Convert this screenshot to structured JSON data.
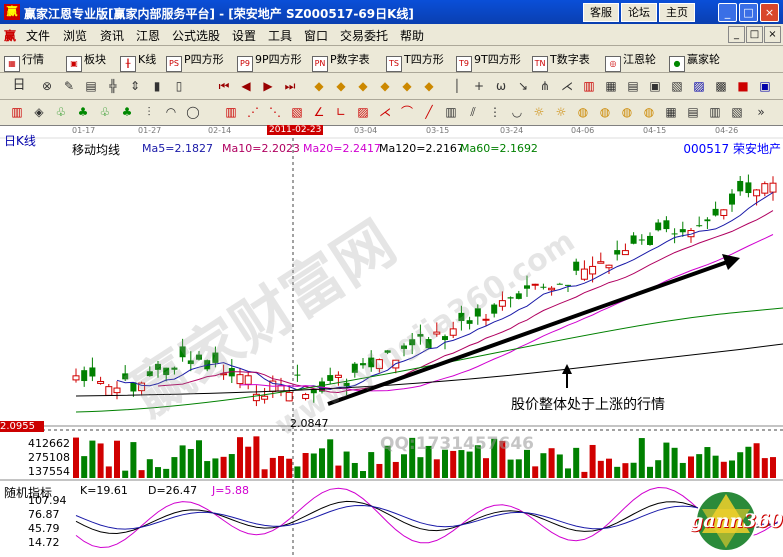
{
  "window": {
    "logo": "赢",
    "title": "赢家江恩专业版[赢家内部服务平台] - [荣安地产   SZ000517-69日K线]",
    "buttons": [
      "客服",
      "论坛",
      "主页"
    ],
    "controls": [
      "_",
      "□",
      "×"
    ]
  },
  "menu": {
    "logo": "赢",
    "items": [
      "文件",
      "浏览",
      "资讯",
      "江恩",
      "公式选股",
      "设置",
      "工具",
      "窗口",
      "交易委托",
      "帮助"
    ],
    "sys": [
      "_",
      "□",
      "×"
    ]
  },
  "toolbar1": {
    "items": [
      {
        "icon": "grid",
        "label": "行情"
      },
      {
        "icon": "blocks",
        "label": "板块"
      },
      {
        "icon": "kline",
        "label": "K线"
      },
      {
        "icon": "PS",
        "label": "P四方形"
      },
      {
        "icon": "P9",
        "label": "9P四方形"
      },
      {
        "icon": "PN",
        "label": "P数字表"
      },
      {
        "icon": "TS",
        "label": "T四方形"
      },
      {
        "icon": "T9",
        "label": "9T四方形"
      },
      {
        "icon": "TN",
        "label": "T数字表"
      },
      {
        "icon": "wheel",
        "label": "江恩轮"
      },
      {
        "icon": "BIG",
        "label": "赢家轮"
      }
    ]
  },
  "toolbar2": {
    "period": "日"
  },
  "chart": {
    "dates": [
      "01-17",
      "01-27",
      "02-14",
      "2011-02-23",
      "03-04",
      "03-15",
      "03-24",
      "04-06",
      "04-15",
      "04-26"
    ],
    "period_label": "日K线",
    "indicator_label": "移动均线",
    "ma": [
      {
        "label": "Ma5=2.1827",
        "color": "#1a1aa8"
      },
      {
        "label": "Ma10=2.2023",
        "color": "#b00060"
      },
      {
        "label": "Ma20=2.2417",
        "color": "#d000d0"
      },
      {
        "label": "Ma120=2.2167",
        "color": "#000000"
      },
      {
        "label": "Ma60=2.1692",
        "color": "#008000"
      }
    ],
    "stock": "000517 荣安地产",
    "price_box": "2.0955",
    "price_low_prefix": "2.0847",
    "low_label": "2.0847",
    "annotation": "股价整体处于上涨的行情",
    "volume_ticks": [
      "412662",
      "275108",
      "137554"
    ],
    "qq": "QQ:1731457646",
    "kdj_title": "随机指标",
    "kdj_values": [
      {
        "label": "K=19.61",
        "color": "#000000"
      },
      {
        "label": "D=26.47",
        "color": "#000000"
      },
      {
        "label": "J=5.88",
        "color": "#d000d0"
      }
    ],
    "kdj_ticks": [
      "107.94",
      "76.87",
      "45.79",
      "14.72"
    ],
    "watermark": "赢家财富网",
    "watermark_url": "www.yingjia360.com",
    "logo_text": "gann360"
  }
}
